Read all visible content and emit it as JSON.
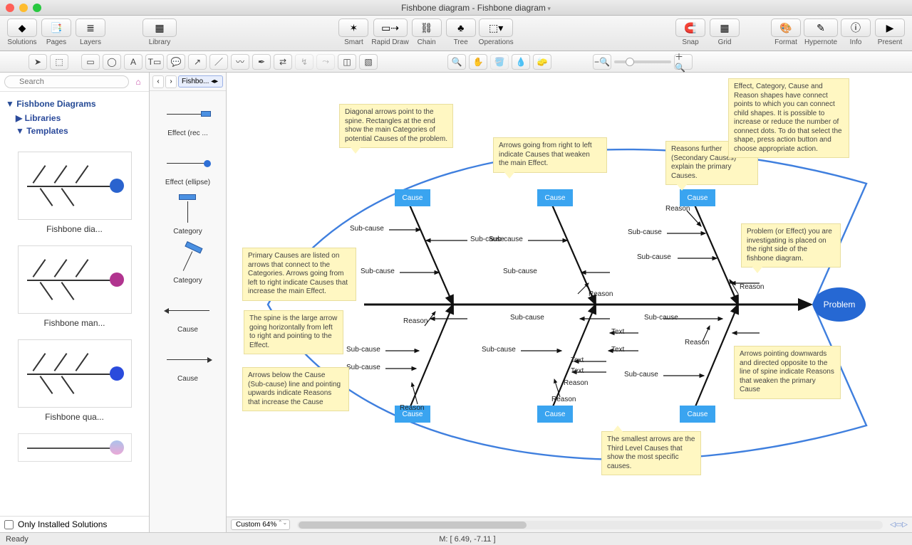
{
  "window": {
    "title": "Fishbone diagram - Fishbone diagram"
  },
  "toolbar": {
    "solutions": "Solutions",
    "pages": "Pages",
    "layers": "Layers",
    "library": "Library",
    "smart": "Smart",
    "rapid": "Rapid Draw",
    "chain": "Chain",
    "tree": "Tree",
    "operations": "Operations",
    "snap": "Snap",
    "grid": "Grid",
    "format": "Format",
    "hypernote": "Hypernote",
    "info": "Info",
    "present": "Present"
  },
  "sidebar": {
    "search_placeholder": "Search",
    "section": "Fishbone Diagrams",
    "libraries": "Libraries",
    "templates_hdr": "Templates",
    "templates": [
      {
        "label": "Fishbone dia...",
        "head": "#2a63ce",
        "box": "#6fb4ef"
      },
      {
        "label": "Fishbone man...",
        "head": "#b1348f",
        "box": "#9bcaf2"
      },
      {
        "label": "Fishbone qua...",
        "head": "#2a4bdc",
        "box": "#6fb4ef"
      }
    ],
    "footer": "Only Installed Solutions"
  },
  "shapepanel": {
    "breadcrumb": "Fishbo...",
    "items": [
      {
        "label": "Effect (rec ...",
        "kind": "rect"
      },
      {
        "label": "Effect (ellipse)",
        "kind": "ellipse"
      },
      {
        "label": "Category",
        "kind": "cat1"
      },
      {
        "label": "Category",
        "kind": "cat2"
      },
      {
        "label": "Cause",
        "kind": "arrowL"
      },
      {
        "label": "Cause",
        "kind": "arrowR"
      }
    ]
  },
  "canvas": {
    "problem": "Problem",
    "cause": "Cause",
    "labels": {
      "subcause": "Sub-cause",
      "reason": "Reason",
      "text": "Text"
    },
    "notes": {
      "n1": "Diagonal arrows point to the spine. Rectangles at the end show the main Categories of potential Causes of the problem.",
      "n2": "Arrows going from right to left indicate Causes that weaken the main Effect.",
      "n3": "Reasons further (Secondary Causes) explain the primary Causes.",
      "n4": "Effect, Category, Cause and Reason shapes have connect points to which you can connect child shapes. It is possible to increase or reduce the number of connect dots. To do that select the shape, press action button and choose appropriate action.",
      "n5": "Problem (or Effect) you are investigating is placed on the right side of the fishbone diagram.",
      "n6": "Primary Causes are listed on arrows that connect to the Categories. Arrows going from left to right indicate Causes that increase the main Effect.",
      "n7": "The spine is the large arrow going horizontally from left to right and pointing to the Effect.",
      "n8": "Arrows below the Cause (Sub-cause) line and pointing upwards indicate Reasons that increase the Cause",
      "n9": "The smallest arrows are the Third Level Causes that show the most specific causes.",
      "n10": "Arrows pointing downwards and directed opposite to the line of spine indicate Reasons that weaken the primary Cause"
    },
    "zoom": "Custom 64%"
  },
  "status": {
    "ready": "Ready",
    "coords": "M: [ 6.49, -7.11 ]"
  }
}
